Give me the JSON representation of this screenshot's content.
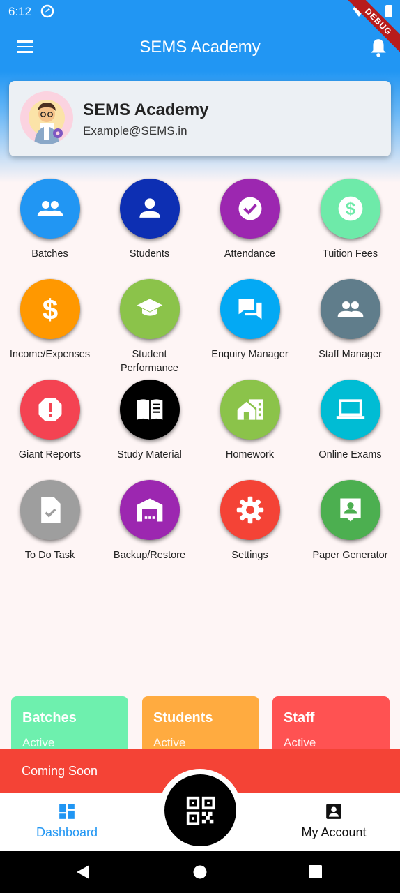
{
  "status_bar": {
    "time": "6:12",
    "debug_label": "DEBUG"
  },
  "app_bar": {
    "title": "SEMS Academy"
  },
  "profile": {
    "name": "SEMS Academy",
    "email": "Example@SEMS.in"
  },
  "menu_items": [
    {
      "label": "Batches",
      "color": "#2196f3",
      "icon": "group-icon"
    },
    {
      "label": "Students",
      "color": "#0d2fb3",
      "icon": "person-icon"
    },
    {
      "label": "Attendance",
      "color": "#9c27b0",
      "icon": "check-circle-icon"
    },
    {
      "label": "Tuition Fees",
      "color": "#6eeaa9",
      "icon": "dollar-circle-icon"
    },
    {
      "label": "Income/Expenses",
      "color": "#ff9800",
      "icon": "dollar-icon"
    },
    {
      "label": "Student Performance",
      "color": "#8bc34a",
      "icon": "school-icon"
    },
    {
      "label": "Enquiry Manager",
      "color": "#03a9f4",
      "icon": "chat-icon"
    },
    {
      "label": "Staff Manager",
      "color": "#607d8b",
      "icon": "group-icon"
    },
    {
      "label": "Giant Reports",
      "color": "#f44352",
      "icon": "report-icon"
    },
    {
      "label": "Study Material",
      "color": "#000000",
      "icon": "book-icon"
    },
    {
      "label": "Homework",
      "color": "#8bc34a",
      "icon": "home-work-icon"
    },
    {
      "label": "Online Exams",
      "color": "#00bcd4",
      "icon": "laptop-icon"
    },
    {
      "label": "To Do Task",
      "color": "#9e9e9e",
      "icon": "task-icon"
    },
    {
      "label": "Backup/Restore",
      "color": "#9c27b0",
      "icon": "warehouse-icon"
    },
    {
      "label": "Settings",
      "color": "#f44336",
      "icon": "settings-icon"
    },
    {
      "label": "Paper Generator",
      "color": "#4caf50",
      "icon": "contact-icon"
    }
  ],
  "stat_cards": [
    {
      "title": "Batches",
      "subtitle": "Active",
      "color": "#6ef0ae"
    },
    {
      "title": "Students",
      "subtitle": "Active",
      "color": "#ffab40"
    },
    {
      "title": "Staff",
      "subtitle": "Active",
      "color": "#ff5252"
    }
  ],
  "banner": {
    "text": "Coming Soon"
  },
  "bottom_nav": {
    "dashboard_label": "Dashboard",
    "account_label": "My Account"
  }
}
